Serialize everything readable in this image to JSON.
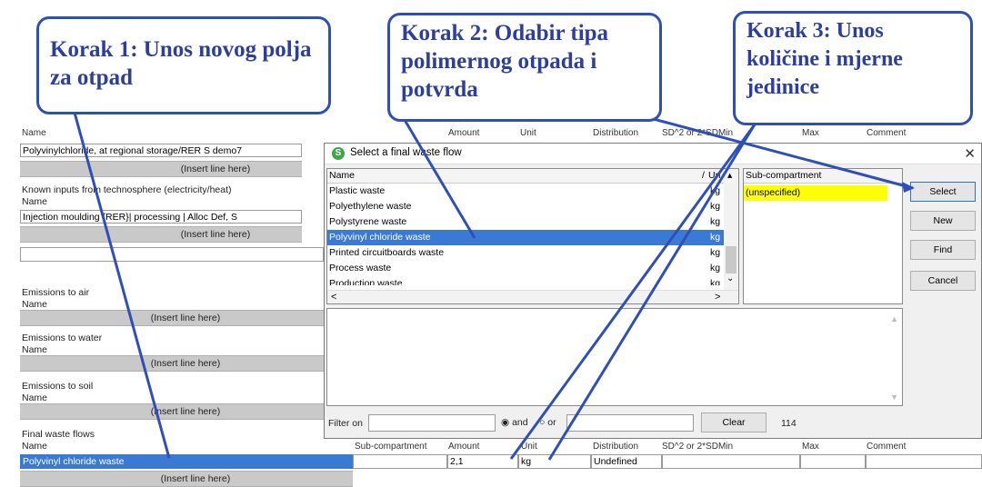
{
  "callouts": {
    "step1": "Korak 1: Unos novog polja za otpad",
    "step2": "Korak 2: Odabir tipa polimernog otpada i potvrda",
    "step3": "Korak 3: Unos količine i mjerne jedinice"
  },
  "background": {
    "top_headers": {
      "name": "Name",
      "amount": "Amount",
      "unit": "Unit",
      "distribution": "Distribution",
      "sd": "SD^2 or 2*SDMin",
      "max": "Max",
      "comment": "Comment"
    },
    "product_value": "Polyvinylchloride, at regional storage/RER S demo7",
    "insert_line": "(Insert line here)",
    "known_inputs_tech": "Known inputs from technosphere (electricity/heat)",
    "name_label": "Name",
    "process_value": "Injection moulding {RER}| processing | Alloc Def, S",
    "emissions_air": "Emissions to air",
    "emissions_water": "Emissions to water",
    "emissions_soil": "Emissions to soil",
    "final_waste": "Final waste flows",
    "bottom_headers": {
      "subcompartment": "Sub-compartment",
      "amount": "Amount",
      "unit": "Unit",
      "distribution": "Distribution",
      "sd": "SD^2 or 2*SDMin",
      "max": "Max",
      "comment": "Comment"
    },
    "waste_row": {
      "name": "Polyvinyl chloride waste",
      "amount": "2,1",
      "unit": "kg",
      "distribution": "Undefined"
    }
  },
  "dialog": {
    "title": "Select a final waste flow",
    "list_headers": {
      "name": "Name",
      "unit": "Un",
      "subcompartment": "Sub-compartment"
    },
    "items": [
      {
        "name": "Plastic waste",
        "unit": "kg"
      },
      {
        "name": "Polyethylene waste",
        "unit": "kg"
      },
      {
        "name": "Polystyrene waste",
        "unit": "kg"
      },
      {
        "name": "Polyvinyl chloride waste",
        "unit": "kg"
      },
      {
        "name": "Printed circuitboards waste",
        "unit": "kg"
      },
      {
        "name": "Process waste",
        "unit": "kg"
      },
      {
        "name": "Production waste",
        "unit": "kg"
      }
    ],
    "subcompartment_item": "(unspecified)",
    "buttons": {
      "select": "Select",
      "new": "New",
      "find": "Find",
      "cancel": "Cancel",
      "clear": "Clear"
    },
    "filter": {
      "label": "Filter on",
      "and": "and",
      "or": "or",
      "count": "114"
    }
  },
  "colors": {
    "callout_blue": "#2f4fb8",
    "selection": "#3a79d4",
    "highlight_yellow": "#ffff00"
  }
}
